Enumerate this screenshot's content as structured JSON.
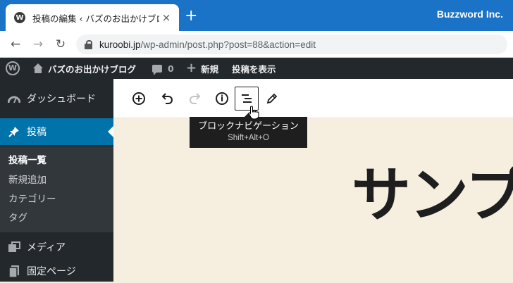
{
  "browser": {
    "tab_title": "投稿の編集 ‹ バズのお出かけブログ —",
    "close_glyph": "×",
    "new_tab_glyph": "+",
    "brand": "Buzzword Inc.",
    "url_host": "kuroobi.jp",
    "url_path": "/wp-admin/post.php?post=88&action=edit",
    "nav": {
      "back": "←",
      "forward": "→",
      "reload": "↻"
    }
  },
  "adminbar": {
    "site_name": "バズのお出かけブログ",
    "comments_count": "0",
    "new_label": "新規",
    "view_post_label": "投稿を表示"
  },
  "sidebar": {
    "dashboard": "ダッシュボード",
    "posts": "投稿",
    "submenu": [
      "投稿一覧",
      "新規追加",
      "カテゴリー",
      "タグ"
    ],
    "media": "メディア",
    "pages": "固定ページ"
  },
  "toolbar": {
    "tooltip_label": "ブロックナビゲーション",
    "tooltip_shortcut": "Shift+Alt+O",
    "info_glyph": "i"
  },
  "canvas": {
    "post_title": "サンプ"
  }
}
